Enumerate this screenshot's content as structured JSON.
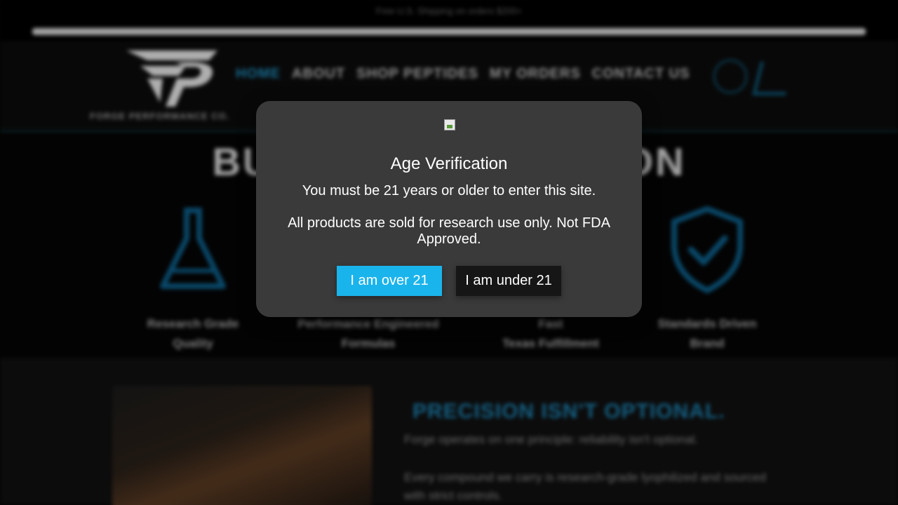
{
  "topbar": {
    "announcement": "Free U.S. Shipping on orders $200+"
  },
  "header": {
    "logo_caption": "FORGE PERFORMANCE CO.",
    "nav": [
      {
        "label": "HOME",
        "active": true
      },
      {
        "label": "ABOUT"
      },
      {
        "label": "SHOP PEPTIDES"
      },
      {
        "label": "MY ORDERS"
      },
      {
        "label": "CONTACT US"
      }
    ],
    "icons": [
      "account-icon",
      "wishlist-icon"
    ]
  },
  "hero": {
    "title": "BUILT FOR PRECISION"
  },
  "features": [
    {
      "icon": "flask-icon",
      "label_line1": "Research Grade",
      "label_line2": "Quality"
    },
    {
      "icon": "formula-icon",
      "label_line1": "Performance Engineered",
      "label_line2": "Formulas"
    },
    {
      "icon": "truck-icon",
      "label_line1": "Fast",
      "label_line2": "Texas Fulfillment"
    },
    {
      "icon": "shield-check-icon",
      "label_line1": "Standards Driven",
      "label_line2": "Brand"
    }
  ],
  "bottom": {
    "heading": "PRECISION ISN'T OPTIONAL.",
    "paragraph1": "Forge operates on one principle: reliability isn't optional.",
    "paragraph2": "Every compound we carry is research-grade lyophilized and sourced with strict controls."
  },
  "modal": {
    "title": "Age Verification",
    "line1": "You must be 21 years or older to enter this site.",
    "line2": "All products are sold for research use only. Not FDA Approved.",
    "btn_over": "I am over 21",
    "btn_under": "I am under 21"
  },
  "colors": {
    "accent": "#1ab4ec",
    "modal_bg": "#3a3a3a",
    "nav_active": "#1f8fc0",
    "icon_blue": "#0d5f8a"
  }
}
